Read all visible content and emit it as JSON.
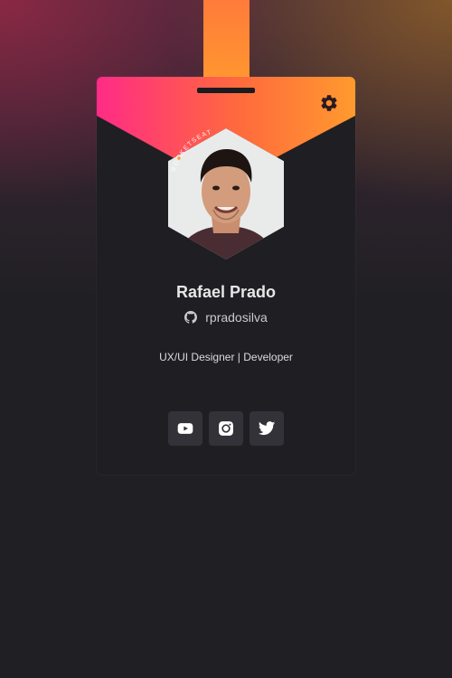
{
  "profile": {
    "name": "Rafael Prado",
    "github_username": "rpradosilva",
    "role": "UX/UI Designer | Developer",
    "badge_text": "ROCKETSEAT"
  },
  "social": [
    {
      "name": "YouTube",
      "icon": "youtube-icon"
    },
    {
      "name": "Instagram",
      "icon": "instagram-icon"
    },
    {
      "name": "Twitter",
      "icon": "twitter-icon"
    }
  ],
  "colors": {
    "background": "#202024",
    "card": "#1f1f23",
    "gradient_start": "#ff2b86",
    "gradient_end": "#ff9a2e",
    "social_button": "#323238",
    "text_primary": "#e6e6e6"
  }
}
